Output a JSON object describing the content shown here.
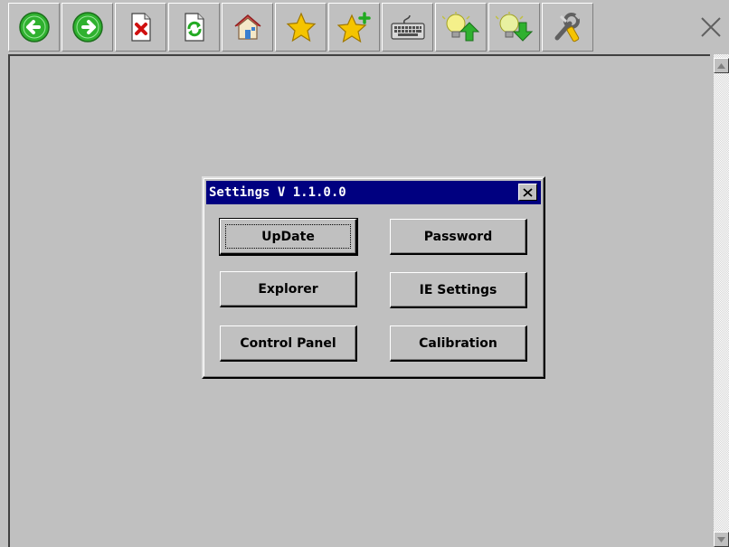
{
  "toolbar": {
    "buttons": [
      {
        "name": "back-button",
        "icon": "back-arrow-icon"
      },
      {
        "name": "forward-button",
        "icon": "forward-arrow-icon"
      },
      {
        "name": "stop-button",
        "icon": "stop-icon"
      },
      {
        "name": "refresh-button",
        "icon": "refresh-icon"
      },
      {
        "name": "home-button",
        "icon": "home-icon"
      },
      {
        "name": "favorites-button",
        "icon": "star-icon"
      },
      {
        "name": "add-favorite-button",
        "icon": "star-plus-icon"
      },
      {
        "name": "keyboard-button",
        "icon": "keyboard-icon"
      },
      {
        "name": "brightness-up-button",
        "icon": "bulb-up-icon"
      },
      {
        "name": "brightness-down-button",
        "icon": "bulb-down-icon"
      },
      {
        "name": "tools-button",
        "icon": "tools-icon"
      }
    ],
    "close_icon": "close-icon"
  },
  "dialog": {
    "title": "Settings V 1.1.0.0",
    "buttons": {
      "update": "UpDate",
      "password": "Password",
      "explorer": "Explorer",
      "ie_settings": "IE Settings",
      "control_panel": "Control Panel",
      "calibration": "Calibration"
    }
  },
  "colors": {
    "face": "#c0c0c0",
    "titlebar": "#000080",
    "icon_green": "#2fb12f",
    "star_yellow": "#f5c400"
  }
}
